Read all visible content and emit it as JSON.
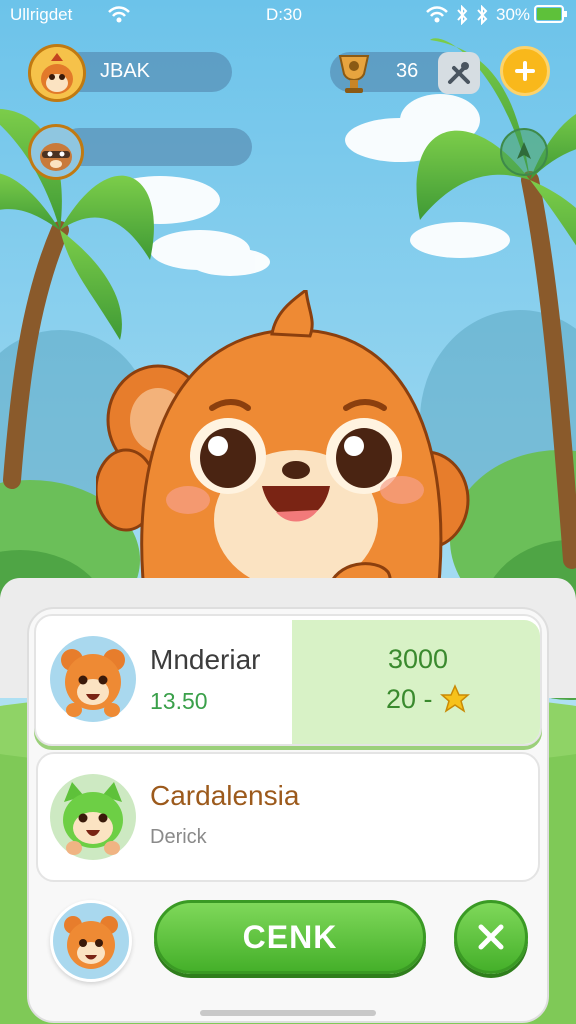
{
  "status_bar": {
    "carrier": "Ullrigdet",
    "time": "D:30",
    "battery": "30%"
  },
  "players": {
    "player1_name": "JBAK",
    "player2_name": ""
  },
  "currency": {
    "amount": "36"
  },
  "cards": {
    "card1": {
      "name": "Mnderiar",
      "value": "13.50",
      "price": "3000",
      "bonus": "20 -"
    },
    "card2": {
      "name": "Cardalensia",
      "subtitle": "Derick"
    }
  },
  "actions": {
    "confirm_label": "CENK"
  },
  "icons": {
    "wifi": "wifi-icon",
    "bluetooth": "bluetooth-icon",
    "battery": "battery-icon",
    "coin": "trophy-coin-icon",
    "tools": "tools-icon",
    "add": "plus-icon",
    "map": "compass-icon",
    "close": "close-icon",
    "star": "star-icon"
  },
  "colors": {
    "sky": "#8fd3ef",
    "accent_green": "#5ec13a",
    "accent_orange": "#f08a2a",
    "price_green": "#3a8a2e",
    "name_brown": "#9c5a1c",
    "add_button": "#f9b81b"
  }
}
